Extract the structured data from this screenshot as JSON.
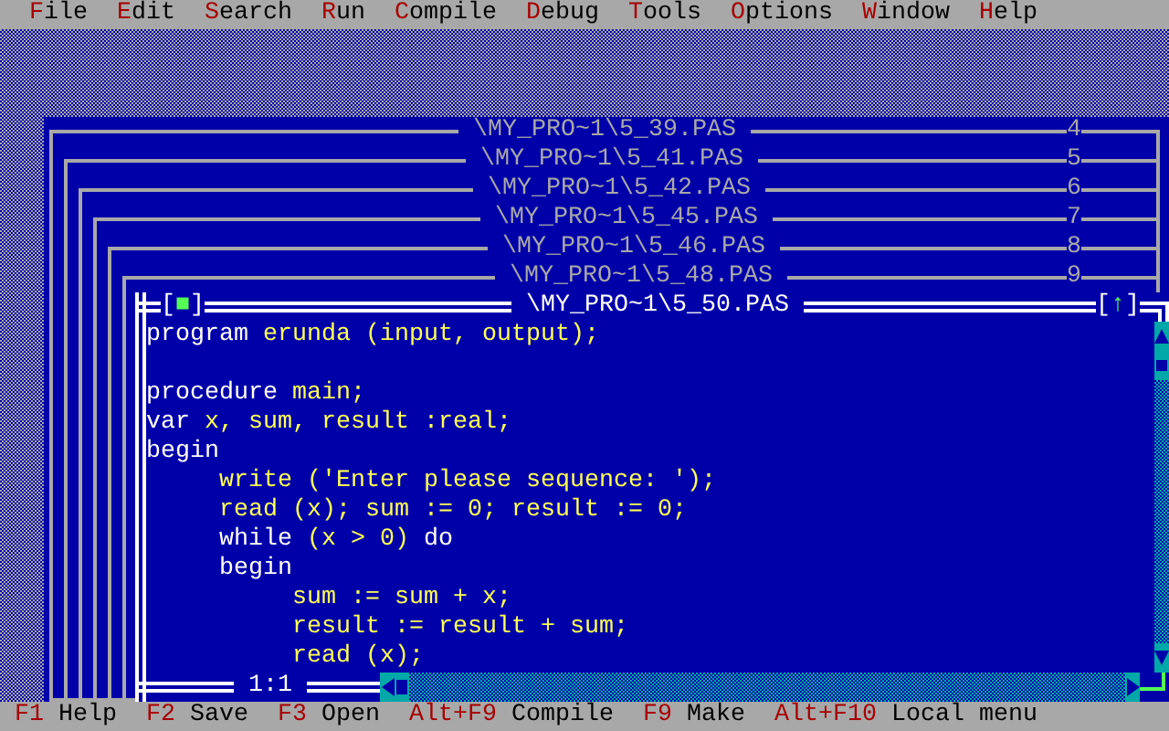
{
  "menu_bar": [
    "File",
    "Edit",
    "Search",
    "Run",
    "Compile",
    "Debug",
    "Tools",
    "Options",
    "Window",
    "Help"
  ],
  "windows": [
    {
      "title": "\\MY_PRO~1\\5_39.PAS",
      "number": "4"
    },
    {
      "title": "\\MY_PRO~1\\5_41.PAS",
      "number": "5"
    },
    {
      "title": "\\MY_PRO~1\\5_42.PAS",
      "number": "6"
    },
    {
      "title": "\\MY_PRO~1\\5_45.PAS",
      "number": "7"
    },
    {
      "title": "\\MY_PRO~1\\5_46.PAS",
      "number": "8"
    },
    {
      "title": "\\MY_PRO~1\\5_48.PAS",
      "number": "9"
    }
  ],
  "editor": {
    "title": "\\MY_PRO~1\\5_50.PAS",
    "close_box": "[■]",
    "zoom_box": "[↑]",
    "lines": [
      {
        "kind": "code",
        "segments": [
          {
            "text": "program",
            "kind": "keyword"
          },
          {
            "text": " erunda (input, output);",
            "kind": "plain"
          }
        ]
      },
      {
        "kind": "blank"
      },
      {
        "kind": "code",
        "segments": [
          {
            "text": "procedure",
            "kind": "keyword"
          },
          {
            "text": " main;",
            "kind": "plain"
          }
        ]
      },
      {
        "kind": "code",
        "segments": [
          {
            "text": "var",
            "kind": "keyword"
          },
          {
            "text": " x, sum, result :real;",
            "kind": "plain"
          }
        ]
      },
      {
        "kind": "code",
        "segments": [
          {
            "text": "begin",
            "kind": "keyword"
          }
        ],
        "children": [
          {
            "kind": "code",
            "segments": [
              {
                "text": "write ('Enter please sequence: ');",
                "kind": "plain"
              }
            ]
          },
          {
            "kind": "code",
            "segments": [
              {
                "text": "read (x); sum := 0; result := 0;",
                "kind": "plain"
              }
            ]
          },
          {
            "kind": "code",
            "segments": [
              {
                "text": "while",
                "kind": "keyword"
              },
              {
                "text": " (x > 0) ",
                "kind": "plain"
              },
              {
                "text": "do",
                "kind": "keyword"
              }
            ]
          },
          {
            "kind": "code",
            "segments": [
              {
                "text": "begin",
                "kind": "keyword"
              }
            ],
            "children": [
              {
                "kind": "code",
                "segments": [
                  {
                    "text": "sum := sum + x;",
                    "kind": "plain"
                  }
                ]
              },
              {
                "kind": "code",
                "segments": [
                  {
                    "text": "result := result + sum;",
                    "kind": "plain"
                  }
                ]
              },
              {
                "kind": "code",
                "segments": [
                  {
                    "text": "read (x);",
                    "kind": "plain"
                  }
                ]
              }
            ]
          }
        ]
      }
    ],
    "cursor_position": "1:1"
  },
  "status_bar": [
    {
      "key": "F1",
      "label": "Help"
    },
    {
      "key": "F2",
      "label": "Save"
    },
    {
      "key": "F3",
      "label": "Open"
    },
    {
      "key": "Alt+F9",
      "label": "Compile"
    },
    {
      "key": "F9",
      "label": "Make"
    },
    {
      "key": "Alt+F10",
      "label": "Local menu"
    }
  ]
}
